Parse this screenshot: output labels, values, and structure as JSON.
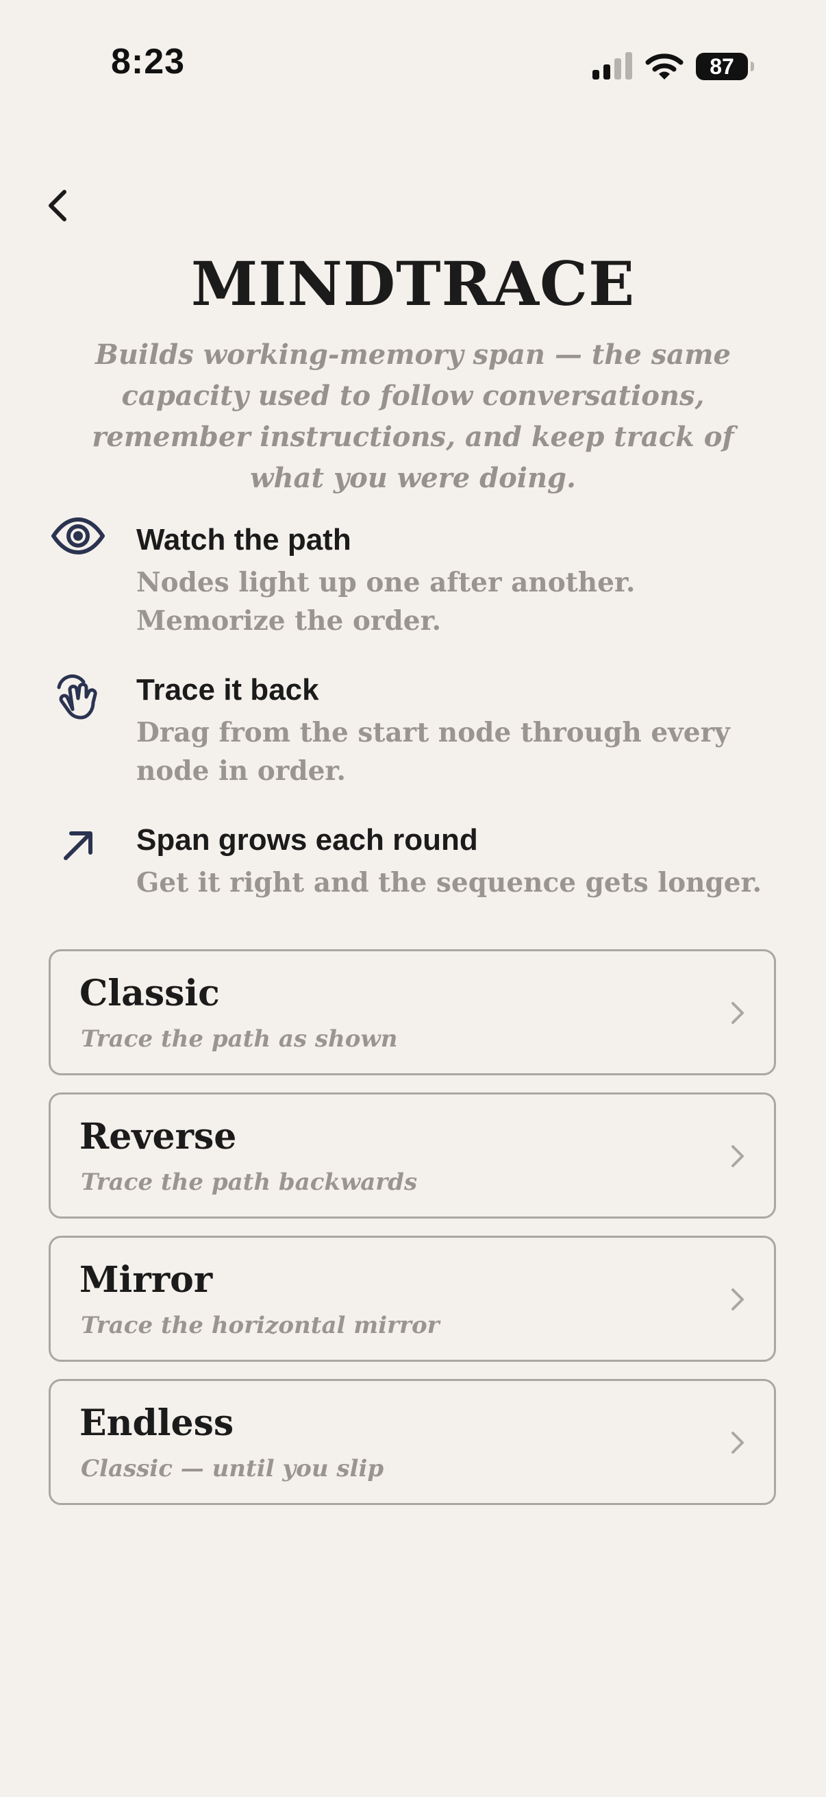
{
  "status_bar": {
    "time": "8:23",
    "battery": "87"
  },
  "header": {
    "title": "MINDTRACE",
    "subtitle": "Builds working-memory span — the same capacity used to follow conversations, remember instructions, and keep track of what you were doing."
  },
  "steps": [
    {
      "icon": "eye-icon",
      "title": "Watch the path",
      "description": "Nodes light up one after another. Memorize the order."
    },
    {
      "icon": "tap-hand-icon",
      "title": "Trace it back",
      "description": "Drag from the start node through every node in order."
    },
    {
      "icon": "arrow-up-right-icon",
      "title": "Span grows each round",
      "description": "Get it right and the sequence gets longer."
    }
  ],
  "modes": [
    {
      "name": "Classic",
      "description": "Trace the path as shown"
    },
    {
      "name": "Reverse",
      "description": "Trace the path backwards"
    },
    {
      "name": "Mirror",
      "description": "Trace the horizontal mirror"
    },
    {
      "name": "Endless",
      "description": "Classic — until you slip"
    }
  ],
  "colors": {
    "background": "#f4f0eb",
    "text": "#1b1b1b",
    "muted": "#9a958f",
    "icon": "#2a3350",
    "card_border": "#aaa6a1"
  }
}
